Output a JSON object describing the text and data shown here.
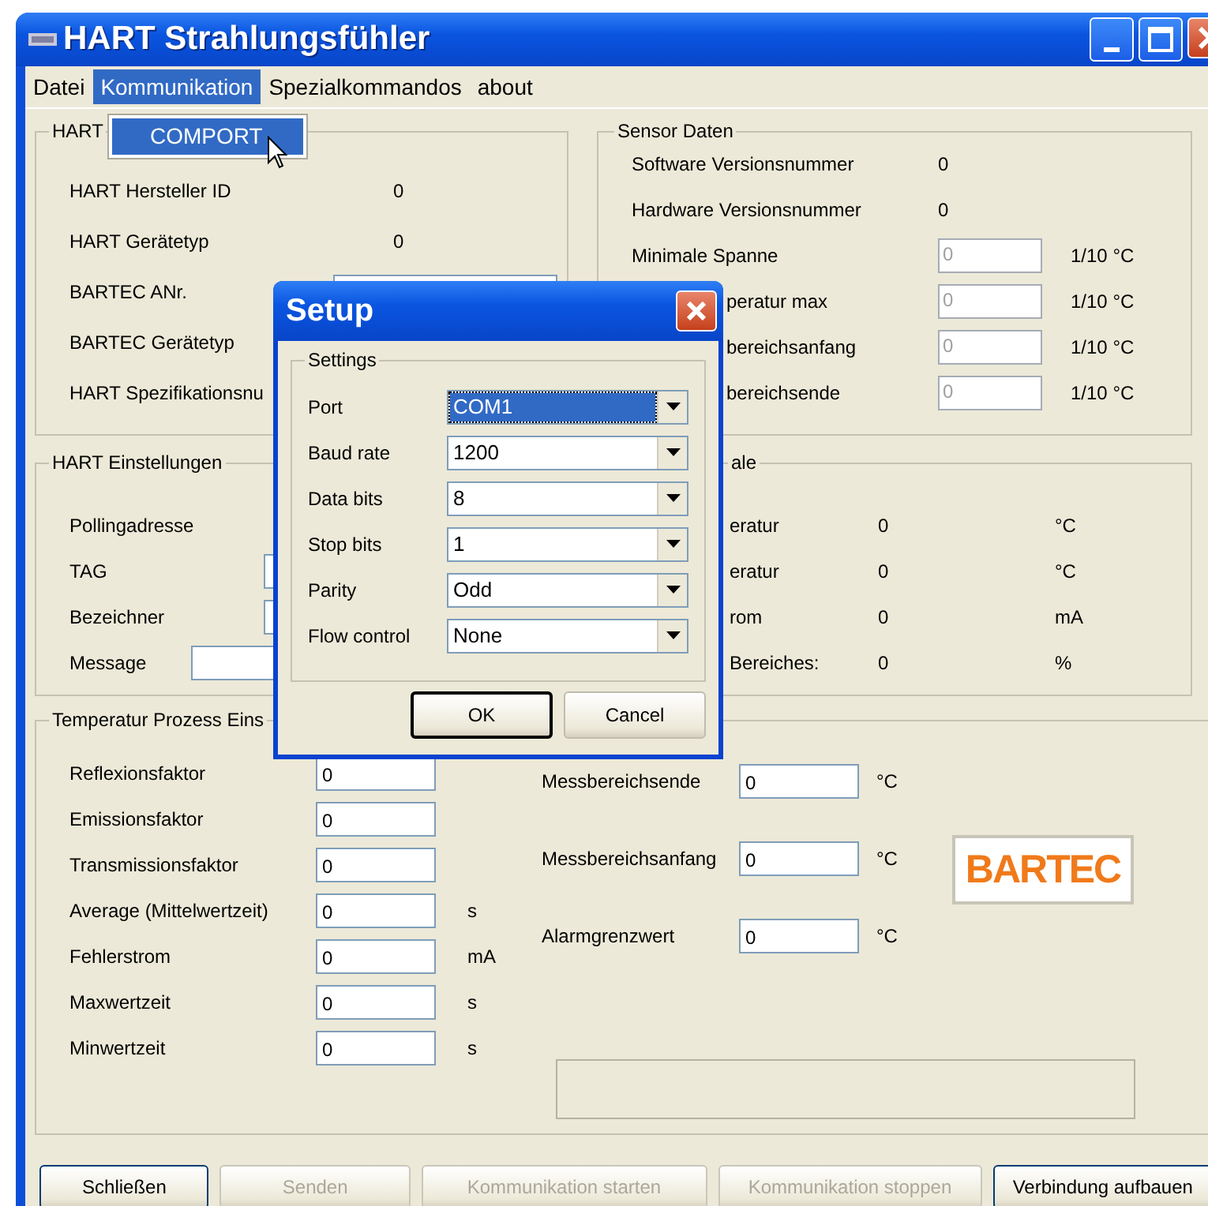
{
  "window": {
    "title": "HART Strahlungsfühler"
  },
  "menu": [
    {
      "label": "Datei",
      "selected": false
    },
    {
      "label": "Kommunikation",
      "selected": true
    },
    {
      "label": "Spezialkommandos",
      "selected": false
    },
    {
      "label": "about",
      "selected": false
    }
  ],
  "dropdown": [
    {
      "label": "COMPORT",
      "selected": true
    }
  ],
  "hart_group": {
    "title": "HART",
    "rows": [
      {
        "label": "HART Hersteller ID",
        "kind": "value",
        "value": "0"
      },
      {
        "label": "HART Gerätetyp",
        "kind": "value",
        "value": "0"
      },
      {
        "label": "BARTEC ANr.",
        "kind": "field"
      },
      {
        "label": "BARTEC Gerätetyp",
        "kind": "label"
      },
      {
        "label": "HART Spezifikationsnu",
        "kind": "label"
      }
    ]
  },
  "sensor_group": {
    "title": "Sensor Daten",
    "rows": [
      {
        "label": "Software Versionsnummer",
        "covered": false,
        "kind": "value",
        "value": "0"
      },
      {
        "label": "Hardware Versionsnummer",
        "covered": false,
        "kind": "value",
        "value": "0"
      },
      {
        "label": "Minimale Spanne",
        "covered": false,
        "kind": "field",
        "value": "0",
        "unit": "1/10 °C"
      },
      {
        "label": "peratur max",
        "covered": true,
        "kind": "field",
        "value": "0",
        "unit": "1/10 °C"
      },
      {
        "label": "bereichsanfang",
        "covered": true,
        "kind": "field",
        "value": "0",
        "unit": "1/10 °C"
      },
      {
        "label": "bereichsende",
        "covered": true,
        "kind": "field",
        "value": "0",
        "unit": "1/10 °C"
      }
    ]
  },
  "settings_group": {
    "title": "HART Einstellungen",
    "rows": [
      {
        "label": "Pollingadresse",
        "kind": "label"
      },
      {
        "label": "TAG",
        "kind": "field"
      },
      {
        "label": "Bezeichner",
        "kind": "field"
      },
      {
        "label": "Message",
        "kind": "long-field"
      }
    ]
  },
  "values_group": {
    "title": "ale",
    "rows": [
      {
        "label": "eratur",
        "value": "0",
        "unit": "°C"
      },
      {
        "label": "eratur",
        "value": "0",
        "unit": "°C"
      },
      {
        "label": "rom",
        "value": "0",
        "unit": "mA"
      },
      {
        "label": "Bereiches:",
        "value": "0",
        "unit": "%"
      }
    ]
  },
  "process_group": {
    "title": "Temperatur Prozess Eins",
    "left_rows": [
      {
        "label": "Reflexionsfaktor",
        "value": "0"
      },
      {
        "label": "Emissionsfaktor",
        "value": "0"
      },
      {
        "label": "Transmissionsfaktor",
        "value": "0"
      },
      {
        "label": "Average (Mittelwertzeit)",
        "value": "0",
        "unit": "s"
      },
      {
        "label": "Fehlerstrom",
        "value": "0",
        "unit": "mA"
      },
      {
        "label": "Maxwertzeit",
        "value": "0",
        "unit": "s"
      },
      {
        "label": "Minwertzeit",
        "value": "0",
        "unit": "s"
      }
    ],
    "right_rows": [
      {
        "label": "Messbereichsende",
        "value": "0",
        "unit": "°C"
      },
      {
        "label": "Messbereichsanfang",
        "value": "0",
        "unit": "°C"
      },
      {
        "label": "Alarmgrenzwert",
        "value": "0",
        "unit": "°C"
      }
    ],
    "logo": "BARTEC"
  },
  "buttons": [
    {
      "label": "Schließen",
      "disabled": false
    },
    {
      "label": "Senden",
      "disabled": true
    },
    {
      "label": "Kommunikation starten",
      "disabled": true
    },
    {
      "label": "Kommunikation stoppen",
      "disabled": true
    },
    {
      "label": "Verbindung aufbauen",
      "disabled": false
    }
  ],
  "dialog": {
    "title": "Setup",
    "group": "Settings",
    "fields": [
      {
        "label": "Port",
        "value": "COM1",
        "selected": true
      },
      {
        "label": "Baud rate",
        "value": "1200",
        "selected": false
      },
      {
        "label": "Data bits",
        "value": "8",
        "selected": false
      },
      {
        "label": "Stop bits",
        "value": "1",
        "selected": false
      },
      {
        "label": "Parity",
        "value": "Odd",
        "selected": false
      },
      {
        "label": "Flow control",
        "value": "None",
        "selected": false
      }
    ],
    "buttons": [
      {
        "label": "OK",
        "default": true
      },
      {
        "label": "Cancel",
        "default": false
      }
    ]
  }
}
